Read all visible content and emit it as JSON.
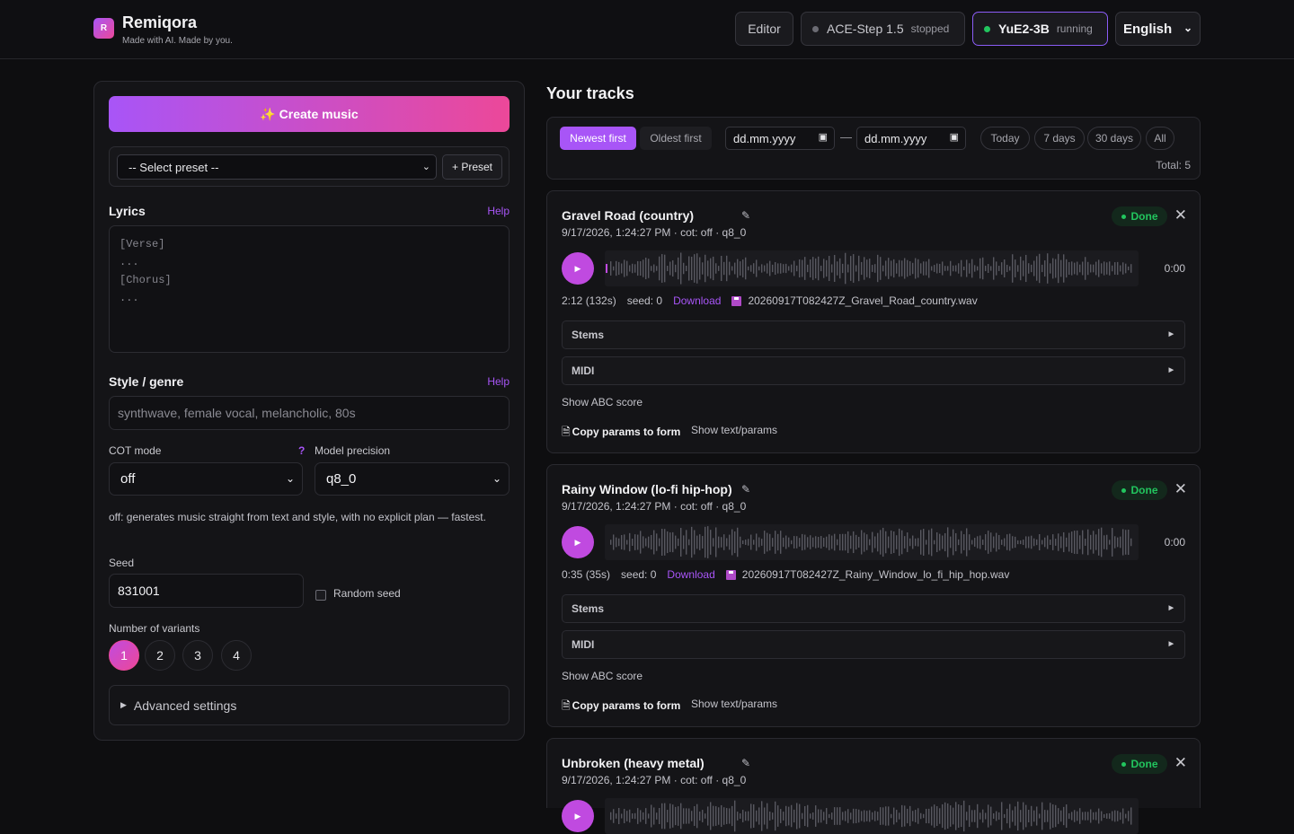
{
  "app": {
    "name": "Remiqora",
    "logo_letter": "R",
    "tagline": "Made with AI. Made by you."
  },
  "header": {
    "editor_label": "Editor",
    "models": [
      {
        "name": "ACE-Step 1.5",
        "status": "stopped"
      },
      {
        "name": "YuE2-3B",
        "status": "running"
      }
    ],
    "language": "English"
  },
  "form": {
    "create_label": "✨ Create music",
    "preset_placeholder": "-- Select preset --",
    "preset_button": "+ Preset",
    "lyrics_label": "Lyrics",
    "help": "Help",
    "lyrics_placeholder": "[Verse]\n...\n[Chorus]\n...",
    "style_label": "Style / genre",
    "style_placeholder": "synthwave, female vocal, melancholic, 80s",
    "cot_label": "COT mode",
    "cot_help": "?",
    "cot_value": "off",
    "precision_label": "Model precision",
    "precision_value": "q8_0",
    "cot_description": "off: generates music straight from text and style, with no explicit plan — fastest.",
    "seed_label": "Seed",
    "seed_value": "831001",
    "random_seed_label": "Random seed",
    "variants_label": "Number of variants",
    "variants": [
      "1",
      "2",
      "3",
      "4"
    ],
    "variants_selected": "1",
    "advanced_label": "Advanced settings"
  },
  "tracks_panel": {
    "title": "Your tracks",
    "sort_newest": "Newest first",
    "sort_oldest": "Oldest first",
    "date_from": "dd.mm.yyyy",
    "date_to": "dd.mm.yyyy",
    "date_sep": "—",
    "ranges": [
      "Today",
      "7 days",
      "30 days",
      "All"
    ],
    "total": "Total: 5"
  },
  "tracks": [
    {
      "title": "Gravel Road (country)",
      "meta": "9/17/2026, 1:24:27 PM · cot: off · q8_0",
      "status": "Done",
      "time": "0:00",
      "duration": "2:12 (132s)",
      "seed": "seed: 0",
      "download": "Download",
      "file": "20260917T082427Z_Gravel_Road_country.wav",
      "stems": "Stems",
      "midi": "MIDI",
      "abc": "Show ABC score",
      "copy": "Copy params to form",
      "show_params": "Show text/params"
    },
    {
      "title": "Rainy Window (lo-fi hip-hop)",
      "meta": "9/17/2026, 1:24:27 PM · cot: off · q8_0",
      "status": "Done",
      "time": "0:00",
      "duration": "0:35 (35s)",
      "seed": "seed: 0",
      "download": "Download",
      "file": "20260917T082427Z_Rainy_Window_lo_fi_hip_hop.wav",
      "stems": "Stems",
      "midi": "MIDI",
      "abc": "Show ABC score",
      "copy": "Copy params to form",
      "show_params": "Show text/params"
    },
    {
      "title": "Unbroken (heavy metal)",
      "meta": "9/17/2026, 1:24:27 PM · cot: off · q8_0",
      "status": "Done"
    }
  ],
  "colors": {
    "accent": "#a855f7",
    "accent2": "#ec4899",
    "success": "#22c55e",
    "background": "#0e0e10"
  },
  "icons": [
    "pencil-icon",
    "close-icon",
    "play-icon",
    "floppy-icon",
    "copy-icon",
    "calendar-icon",
    "chevron-down-icon",
    "triangle-right-icon"
  ]
}
